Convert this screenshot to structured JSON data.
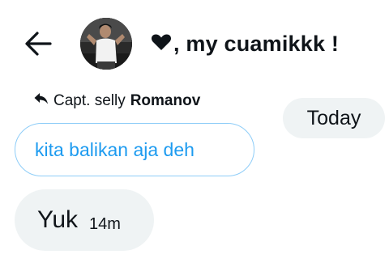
{
  "header": {
    "back_icon": "arrow-left-icon",
    "avatar_icon": "profile-photo",
    "heart_icon": "heart-icon",
    "title_text": ", my cuamikkk !"
  },
  "reply": {
    "icon": "reply-arrow-icon",
    "name_normal": "Capt. selly",
    "name_bold": "Romanov"
  },
  "date_separator": "Today",
  "quoted_message": "kita balikan aja deh",
  "message": {
    "text": "Yuk",
    "time": "14m"
  },
  "colors": {
    "text": "#0f1419",
    "accent_blue": "#1d9bf0",
    "quote_border": "#8ecdf8",
    "bubble_gray": "#eff3f4"
  }
}
